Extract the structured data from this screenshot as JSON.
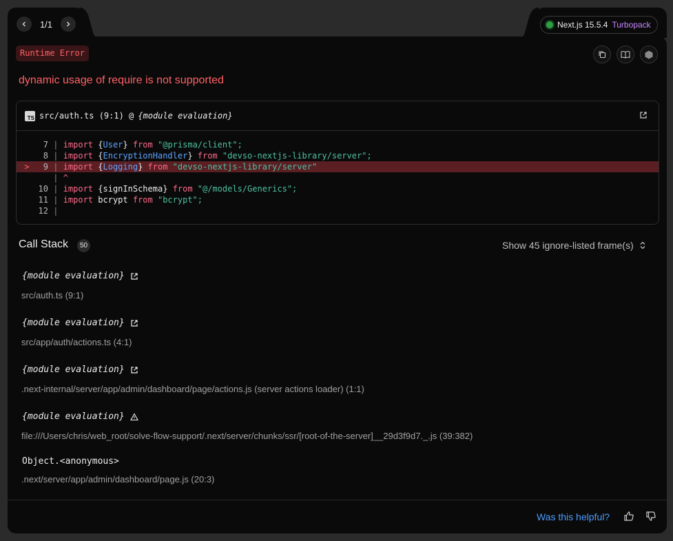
{
  "header": {
    "pager_text": "1/1",
    "version_label": "Next.js 15.5.4",
    "bundler_label": "Turbopack"
  },
  "error": {
    "badge": "Runtime Error",
    "message": "dynamic usage of require is not supported"
  },
  "code_frame": {
    "file_label": "src/auth.ts (9:1) @",
    "context_label": "{module evaluation}",
    "lines": [
      {
        "num": "7",
        "kw": "import",
        "open": " {",
        "id": "User",
        "close": "} ",
        "from": "from",
        "str": " \"@prisma/client\";",
        "rest": "",
        "hl": false
      },
      {
        "num": "8",
        "kw": "import",
        "open": " {",
        "id": "EncryptionHandler",
        "close": "} ",
        "from": "from",
        "str": " \"devso-nextjs-library/server\";",
        "rest": "",
        "hl": false
      },
      {
        "num": "9",
        "kw": "import",
        "open": " {",
        "id": "Logging",
        "close": "} ",
        "from": "from",
        "str": " \"devso-nextjs-library/server\"",
        "rest": "",
        "hl": true
      },
      {
        "num": "",
        "kw": "^",
        "open": "",
        "id": "",
        "close": "",
        "from": "",
        "str": "",
        "rest": "",
        "hl": false
      },
      {
        "num": "10",
        "kw": "import",
        "open": " {signInSchema} ",
        "id": "",
        "close": "",
        "from": "from",
        "str": " \"@/models/Generics\";",
        "rest": "",
        "hl": false
      },
      {
        "num": "11",
        "kw": "import",
        "open": " bcrypt ",
        "id": "",
        "close": "",
        "from": "from",
        "str": " \"bcrypt\";",
        "rest": "",
        "hl": false
      },
      {
        "num": "12",
        "kw": "",
        "open": "",
        "id": "",
        "close": "",
        "from": "",
        "str": "",
        "rest": "",
        "hl": false
      }
    ],
    "highlight_marker": ">"
  },
  "call_stack": {
    "title": "Call Stack",
    "count": "50",
    "ignore_label": "Show 45 ignore-listed frame(s)",
    "frames": [
      {
        "fn": "{module evaluation}",
        "loc": "src/auth.ts (9:1)",
        "icon": "external-link-icon"
      },
      {
        "fn": "{module evaluation}",
        "loc": "src/app/auth/actions.ts (4:1)",
        "icon": "external-link-icon"
      },
      {
        "fn": "{module evaluation}",
        "loc": ".next-internal/server/app/admin/dashboard/page/actions.js (server actions loader) (1:1)",
        "icon": "external-link-icon"
      },
      {
        "fn": "{module evaluation}",
        "loc": "file:///Users/chris/web_root/solve-flow-support/.next/server/chunks/ssr/[root-of-the-server]__29d3f9d7._.js (39:382)",
        "icon": "warning-icon"
      },
      {
        "fn": "Object.<anonymous>",
        "loc": ".next/server/app/admin/dashboard/page.js (20:3)",
        "icon": ""
      }
    ]
  },
  "footer": {
    "helpful_label": "Was this helpful?"
  },
  "colors": {
    "error": "#ff6166",
    "link": "#4b9dff",
    "turbopack": "#c686ff",
    "status_dot": "#2ea043"
  }
}
